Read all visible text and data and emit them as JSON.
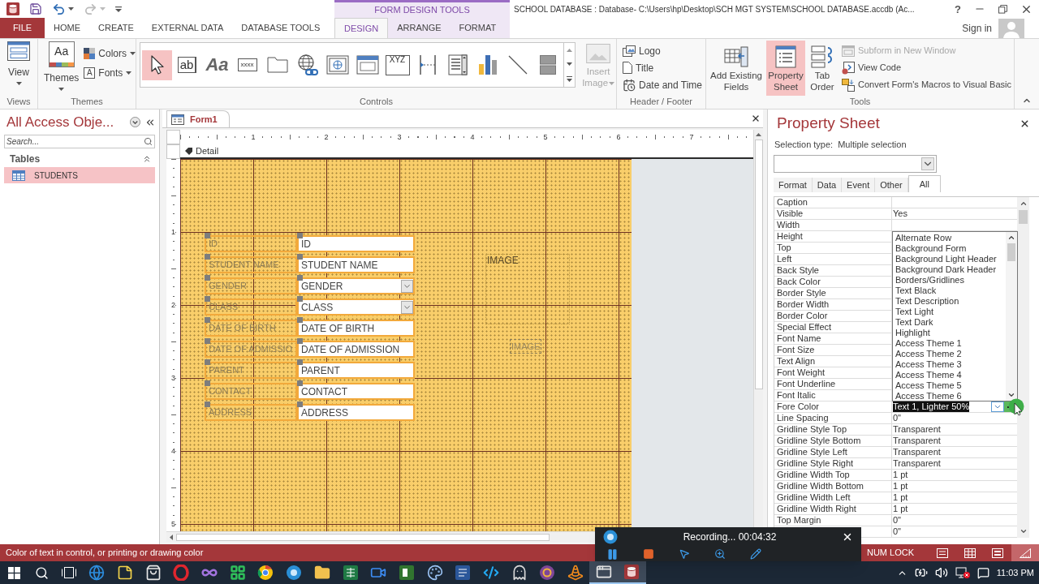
{
  "title_bar": {
    "contextual_group": "FORM DESIGN TOOLS",
    "title": "SCHOOL DATABASE : Database- C:\\Users\\hp\\Desktop\\SCH MGT SYSTEM\\SCHOOL DATABASE.accdb (Ac...",
    "help": "?"
  },
  "ribbon_tabs": [
    {
      "label": "FILE",
      "kind": "file",
      "selected": false
    },
    {
      "label": "HOME",
      "kind": "standard",
      "selected": false
    },
    {
      "label": "CREATE",
      "kind": "standard",
      "selected": false
    },
    {
      "label": "EXTERNAL DATA",
      "kind": "standard",
      "selected": false
    },
    {
      "label": "DATABASE TOOLS",
      "kind": "standard",
      "selected": false
    },
    {
      "label": "DESIGN",
      "kind": "contextual",
      "selected": true
    },
    {
      "label": "ARRANGE",
      "kind": "contextual",
      "selected": false
    },
    {
      "label": "FORMAT",
      "kind": "contextual",
      "selected": false
    }
  ],
  "account": {
    "label": "Sign in"
  },
  "ribbon": {
    "views": {
      "label": "Views",
      "button": "View"
    },
    "themes": {
      "label": "Themes",
      "button": "Themes",
      "button_glyph": "Aa",
      "colors": "Colors",
      "fonts": "Fonts",
      "fonts_glyph": "A"
    },
    "controls": {
      "label": "Controls",
      "tools": [
        {
          "kind": "select",
          "selected": true
        },
        {
          "kind": "text-box",
          "glyph": "ab",
          "selected": false
        },
        {
          "kind": "label",
          "glyph": "Aa",
          "selected": false
        },
        {
          "kind": "button",
          "glyph": "xxxx",
          "selected": false
        },
        {
          "kind": "tab-control",
          "selected": false
        },
        {
          "kind": "hyperlink",
          "selected": false
        },
        {
          "kind": "web-browser",
          "selected": false
        },
        {
          "kind": "navigation",
          "selected": false
        },
        {
          "kind": "option-group",
          "glyph": "XYZ",
          "selected": false
        },
        {
          "kind": "page-break",
          "selected": false
        },
        {
          "kind": "list",
          "selected": false
        },
        {
          "kind": "chart",
          "selected": false
        },
        {
          "kind": "line",
          "selected": false
        },
        {
          "kind": "toggle",
          "selected": false
        }
      ],
      "insert_image": {
        "label": "Insert Image",
        "disabled": true
      }
    },
    "header_footer": {
      "label": "Header / Footer",
      "buttons": [
        {
          "kind": "logo",
          "label": "Logo"
        },
        {
          "kind": "title",
          "label": "Title"
        },
        {
          "kind": "date-time",
          "label": "Date and Time"
        }
      ]
    },
    "tools": {
      "label": "Tools",
      "large_buttons": [
        {
          "kind": "add-fields",
          "label": "Add Existing Fields",
          "selected": false
        },
        {
          "kind": "property-sheet",
          "label": "Property Sheet",
          "selected": true
        },
        {
          "kind": "tab-order",
          "label": "Tab Order",
          "selected": false
        }
      ],
      "small_buttons": [
        {
          "kind": "subform",
          "label": "Subform in New Window",
          "disabled": true
        },
        {
          "kind": "view-code",
          "label": "View Code",
          "disabled": false
        },
        {
          "kind": "convert",
          "label": "Convert Form's Macros to Visual Basic",
          "disabled": false
        }
      ]
    }
  },
  "navigation_pane": {
    "title": "All Access Obje...",
    "search": {
      "placeholder": "Search..."
    },
    "groups": [
      {
        "label": "Tables",
        "expanded": true,
        "items": [
          {
            "label": "STUDENTS",
            "selected": true
          }
        ]
      }
    ]
  },
  "document": {
    "tabs": [
      {
        "label": "Form1",
        "selected": true
      }
    ],
    "ruler": {
      "horizontal": [
        "1",
        "2",
        "3",
        "4",
        "5",
        "6",
        "7"
      ],
      "vertical": [
        "1",
        "2",
        "3",
        "4",
        "5"
      ]
    },
    "section": "Detail",
    "controls": [
      {
        "label": "ID",
        "field": "ID",
        "kind": "text-box",
        "label_selected": true,
        "field_selected": true
      },
      {
        "label": "STUDENT NAME",
        "field": "STUDENT NAME",
        "kind": "text-box",
        "label_selected": true,
        "field_selected": true
      },
      {
        "label": "GENDER",
        "field": "GENDER",
        "kind": "combo-box",
        "label_selected": true,
        "field_selected": true
      },
      {
        "label": "CLASS",
        "field": "CLASS",
        "kind": "combo-box",
        "label_selected": true,
        "field_selected": true
      },
      {
        "label": "DATE OF BIRTH",
        "field": "DATE OF BIRTH",
        "kind": "text-box",
        "label_selected": true,
        "field_selected": true
      },
      {
        "label": "DATE OF ADMISSIO",
        "field": "DATE OF ADMISSION",
        "kind": "text-box",
        "label_selected": true,
        "field_selected": true
      },
      {
        "label": "PARENT",
        "field": "PARENT",
        "kind": "text-box",
        "label_selected": true,
        "field_selected": true
      },
      {
        "label": "CONTACT",
        "field": "CONTACT",
        "kind": "text-box",
        "label_selected": true,
        "field_selected": true
      },
      {
        "label": "ADDRESS",
        "field": "ADDRESS",
        "kind": "text-box",
        "label_selected": true,
        "field_selected": true
      }
    ],
    "image_frame": {
      "label": "IMAGE"
    },
    "image_label": {
      "label": "IMAGE"
    }
  },
  "property_sheet": {
    "title": "Property Sheet",
    "selection_type_label": "Selection type:",
    "selection_type": "Multiple selection",
    "tabs": [
      {
        "label": "Format",
        "selected": false
      },
      {
        "label": "Data",
        "selected": false
      },
      {
        "label": "Event",
        "selected": false
      },
      {
        "label": "Other",
        "selected": false
      },
      {
        "label": "All",
        "selected": true
      }
    ],
    "properties": [
      {
        "name": "Caption",
        "selected": false
      },
      {
        "name": "Visible",
        "value": "Yes",
        "selected": false
      },
      {
        "name": "Width",
        "selected": false
      },
      {
        "name": "Height",
        "selected": false
      },
      {
        "name": "Top",
        "selected": false
      },
      {
        "name": "Left",
        "selected": false
      },
      {
        "name": "Back Style",
        "selected": false
      },
      {
        "name": "Back Color",
        "selected": false
      },
      {
        "name": "Border Style",
        "selected": false
      },
      {
        "name": "Border Width",
        "selected": false
      },
      {
        "name": "Border Color",
        "selected": false
      },
      {
        "name": "Special Effect",
        "selected": false
      },
      {
        "name": "Font Name",
        "selected": false
      },
      {
        "name": "Font Size",
        "selected": false
      },
      {
        "name": "Text Align",
        "selected": false
      },
      {
        "name": "Font Weight",
        "selected": false
      },
      {
        "name": "Font Underline",
        "selected": false
      },
      {
        "name": "Font Italic",
        "selected": false
      },
      {
        "name": "Fore Color",
        "value": "Text 1, Lighter 50%",
        "selected": true
      },
      {
        "name": "Line Spacing",
        "value": "0\"",
        "selected": false
      },
      {
        "name": "Gridline Style Top",
        "value": "Transparent",
        "selected": false
      },
      {
        "name": "Gridline Style Bottom",
        "value": "Transparent",
        "selected": false
      },
      {
        "name": "Gridline Style Left",
        "value": "Transparent",
        "selected": false
      },
      {
        "name": "Gridline Style Right",
        "value": "Transparent",
        "selected": false
      },
      {
        "name": "Gridline Width Top",
        "value": "1 pt",
        "selected": false
      },
      {
        "name": "Gridline Width Bottom",
        "value": "1 pt",
        "selected": false
      },
      {
        "name": "Gridline Width Left",
        "value": "1 pt",
        "selected": false
      },
      {
        "name": "Gridline Width Right",
        "value": "1 pt",
        "selected": false
      },
      {
        "name": "Top Margin",
        "value": "0\"",
        "selected": false
      },
      {
        "value": "0\"",
        "selected": false
      }
    ],
    "color_list": {
      "items": [
        "Alternate Row",
        "Background Form",
        "Background Light Header",
        "Background Dark Header",
        "Borders/Gridlines",
        "Text Black",
        "Text Description",
        "Text Light",
        "Text Dark",
        "Highlight",
        "Access Theme 1",
        "Access Theme 2",
        "Access Theme 3",
        "Access Theme 4",
        "Access Theme 5",
        "Access Theme 6"
      ]
    }
  },
  "status_bar": {
    "message": "Color of text in control, or printing or drawing color",
    "indicator": "NUM LOCK",
    "views": [
      {
        "kind": "form",
        "selected": false
      },
      {
        "kind": "datasheet",
        "selected": false
      },
      {
        "kind": "layout",
        "selected": false
      },
      {
        "kind": "design",
        "selected": true
      }
    ]
  },
  "recorder": {
    "status": "Recording... 00:04:32"
  },
  "taskbar": {
    "apps": [
      {
        "kind": "globe",
        "active": false
      },
      {
        "kind": "note",
        "active": false
      },
      {
        "kind": "bag",
        "active": false
      },
      {
        "kind": "ring",
        "active": false
      },
      {
        "kind": "infinity",
        "active": false
      },
      {
        "kind": "grid",
        "active": false
      },
      {
        "kind": "wheel",
        "active": false
      },
      {
        "kind": "webcam",
        "active": false
      },
      {
        "kind": "folder",
        "active": false
      },
      {
        "kind": "sheet",
        "active": false
      },
      {
        "kind": "camera",
        "active": false
      },
      {
        "kind": "tile",
        "active": false
      },
      {
        "kind": "palette",
        "active": false
      },
      {
        "kind": "doc",
        "active": false
      },
      {
        "kind": "code",
        "active": false
      },
      {
        "kind": "ghost",
        "active": false
      },
      {
        "kind": "orb",
        "active": false
      },
      {
        "kind": "cone",
        "active": false
      },
      {
        "kind": "window",
        "active": true
      },
      {
        "kind": "database",
        "active": true
      }
    ],
    "clock": "11:03 PM"
  }
}
